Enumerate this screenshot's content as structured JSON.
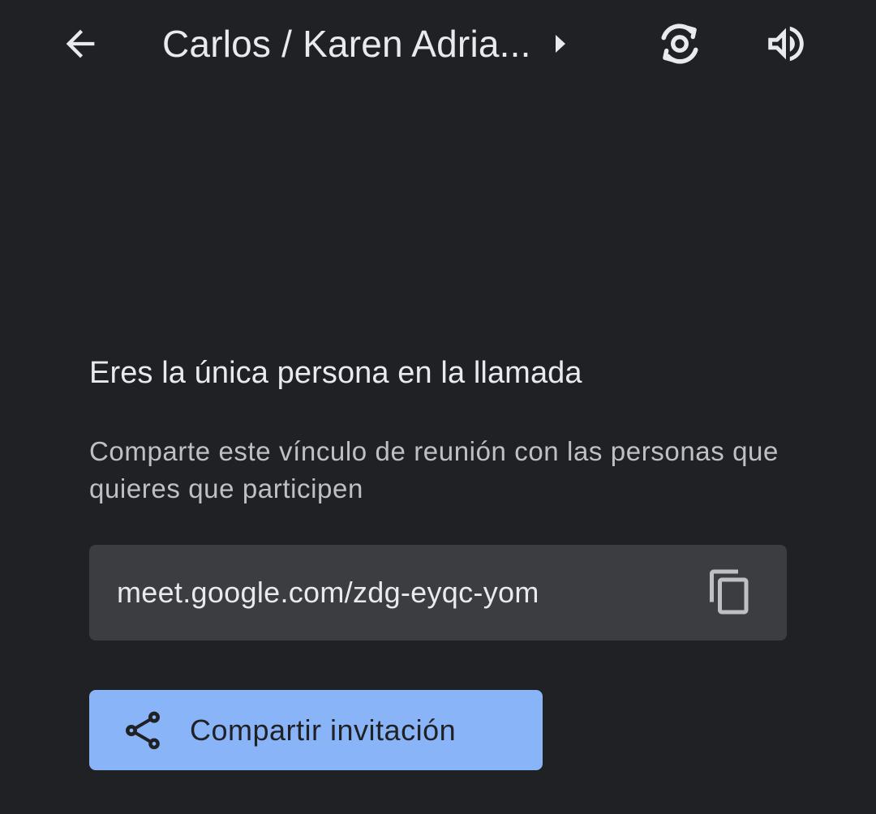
{
  "topbar": {
    "title": "Carlos / Karen Adria...",
    "icons": {
      "back": "arrow-back-icon",
      "caret": "caret-right-icon",
      "switch_camera": "switch-camera-icon",
      "audio": "volume-icon"
    }
  },
  "main": {
    "heading": "Eres la única persona en la llamada",
    "description": "Comparte este vínculo de reunión con las personas que quieres que participen",
    "meeting_link": "meet.google.com/zdg-eyqc-yom",
    "share_button_label": "Compartir invitación"
  },
  "colors": {
    "background": "#202124",
    "link_box": "#3c3d41",
    "accent": "#8ab4f8",
    "text_primary": "#e8eaed",
    "text_secondary": "#bdc1c6"
  }
}
